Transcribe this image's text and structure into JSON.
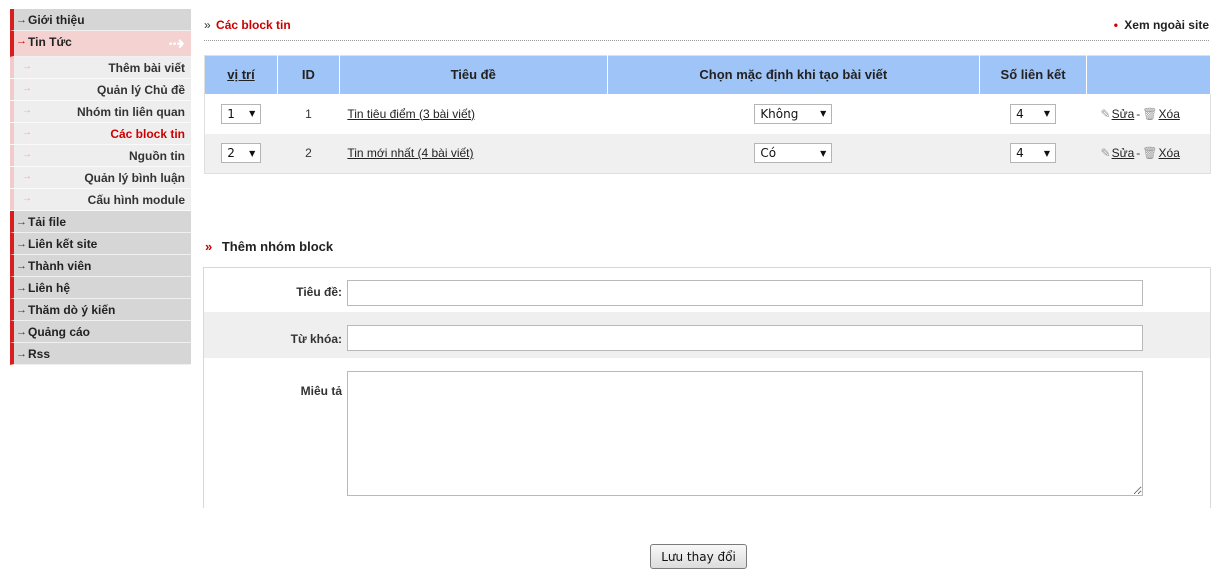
{
  "sidebar": {
    "items_before": [
      {
        "label": "Giới thiệu"
      }
    ],
    "active": {
      "label": "Tin Tức",
      "icon": "double-right-arrow-icon"
    },
    "sub_items": [
      {
        "label": "Thêm bài viết"
      },
      {
        "label": "Quản lý Chủ đề"
      },
      {
        "label": "Nhóm tin liên quan"
      },
      {
        "label": "Các block tin"
      },
      {
        "label": "Nguồn tin"
      },
      {
        "label": "Quản lý bình luận"
      },
      {
        "label": "Cấu hình module"
      }
    ],
    "items_after": [
      {
        "label": "Tải file"
      },
      {
        "label": "Liên kết site"
      },
      {
        "label": "Thành viên"
      },
      {
        "label": "Liên hệ"
      },
      {
        "label": "Thăm dò ý kiến"
      },
      {
        "label": "Quảng cáo"
      },
      {
        "label": "Rss"
      }
    ]
  },
  "breadcrumb": {
    "label": "Các block tin"
  },
  "view_site": {
    "label": "Xem ngoài site"
  },
  "table": {
    "headers": [
      "vị trí",
      "ID",
      "Tiêu đề",
      "Chọn mặc định khi tạo bài viết",
      "Số liên kết",
      ""
    ],
    "rows": [
      {
        "position": "1",
        "id": "1",
        "title": "Tin tiêu điểm (3 bài viết)",
        "default": "Không",
        "links": "4",
        "edit": "Sửa",
        "sep": "-",
        "delete": "Xóa"
      },
      {
        "position": "2",
        "id": "2",
        "title": "Tin mới nhất (4 bài viết)",
        "default": "Có",
        "links": "4",
        "edit": "Sửa",
        "sep": "-",
        "delete": "Xóa"
      }
    ]
  },
  "add_block": {
    "heading": "Thêm nhóm block",
    "title_label": "Tiêu đề:",
    "title_value": "",
    "keyword_label": "Từ khóa:",
    "keyword_value": "",
    "desc_label": "Miêu tả",
    "desc_value": ""
  },
  "save_button": "Lưu thay đổi",
  "colors": {
    "accent_red": "#cc0000",
    "table_header": "#9fc4f7",
    "sidebar_active": "#f4d2d2",
    "sidebar_item": "#d6d6d6"
  }
}
